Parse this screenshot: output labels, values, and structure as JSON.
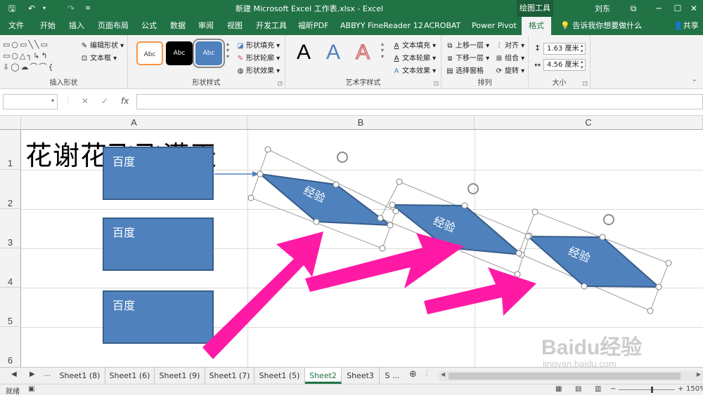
{
  "titlebar": {
    "title": "新建 Microsoft Excel 工作表.xlsx  -  Excel",
    "context_tab": "绘图工具",
    "user": "刘东"
  },
  "tabs": [
    "文件",
    "开始",
    "插入",
    "页面布局",
    "公式",
    "数据",
    "审阅",
    "视图",
    "开发工具",
    "福昕PDF",
    "ABBYY FineReader 12",
    "ACROBAT",
    "Power Pivot",
    "格式"
  ],
  "active_tab": "格式",
  "tell_me": "告诉我你想要做什么",
  "share": "共享",
  "ribbon": {
    "insert_shapes": {
      "label": "插入形状",
      "edit_shape": "编辑形状",
      "text_box": "文本框"
    },
    "shape_styles": {
      "label": "形状样式",
      "sample": "Abc",
      "fill": "形状填充",
      "outline": "形状轮廓",
      "effects": "形状效果"
    },
    "wordart": {
      "label": "艺术字样式",
      "sample": "A",
      "text_fill": "文本填充",
      "text_outline": "文本轮廓",
      "text_effects": "文本效果"
    },
    "arrange": {
      "label": "排列",
      "bring_forward": "上移一层",
      "send_backward": "下移一层",
      "selection_pane": "选择窗格",
      "align": "对齐",
      "group": "组合",
      "rotate": "旋转"
    },
    "size": {
      "label": "大小",
      "height": "1.63 厘米",
      "width": "4.56 厘米"
    }
  },
  "formula_bar": {
    "name_box": "",
    "formula": "",
    "fx": "fx"
  },
  "grid": {
    "columns": [
      "A",
      "B",
      "C"
    ],
    "rows": [
      "1",
      "2",
      "3",
      "4",
      "5",
      "6"
    ],
    "cell_a1": "花谢花飞飞满天"
  },
  "shapes": {
    "rect_label": "百度",
    "parallelogram_label": "经验"
  },
  "sheets": [
    "Sheet1 (8)",
    "Sheet1 (6)",
    "Sheet1 (9)",
    "Sheet1 (7)",
    "Sheet1 (5)",
    "Sheet2",
    "Sheet3",
    "S ..."
  ],
  "active_sheet": "Sheet2",
  "status": {
    "ready": "就绪",
    "zoom": "150%"
  },
  "watermark": {
    "logo": "Baidu经验",
    "url": "jingyan.baidu.com"
  },
  "colors": {
    "excel_green": "#217346",
    "shape_fill": "#4f81bd",
    "shape_border": "#385d8a",
    "arrow": "#ff1aa6"
  }
}
